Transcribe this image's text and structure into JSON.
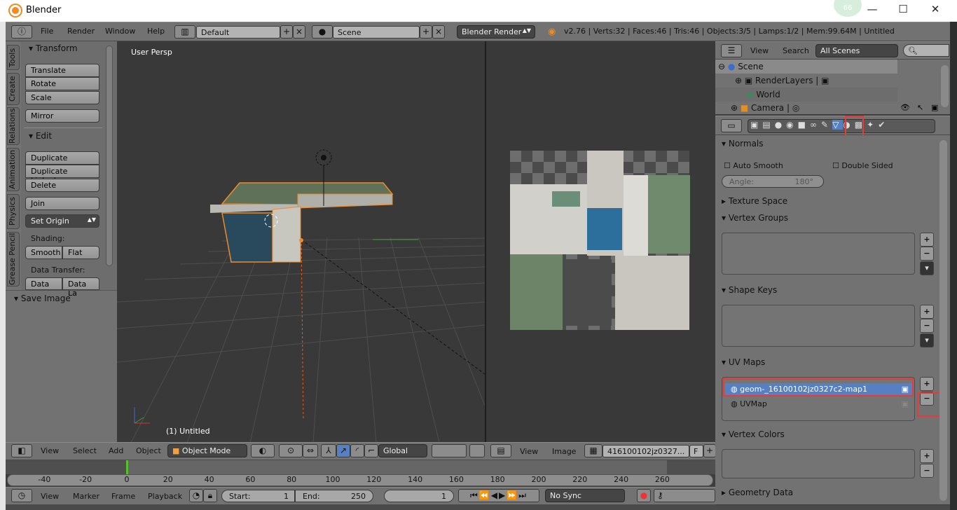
{
  "window": {
    "title": "Blender",
    "badge": "66"
  },
  "info_header": {
    "menus": [
      "File",
      "Render",
      "Window",
      "Help"
    ],
    "layout": "Default",
    "scene": "Scene",
    "engine": "Blender Render",
    "stats": "v2.76 | Verts:32 | Faces:46 | Tris:46 | Objects:3/5 | Lamps:1/2 | Mem:99.64M | Untitled"
  },
  "tool_shelf": {
    "tabs": [
      "Tools",
      "Create",
      "Relations",
      "Animation",
      "Physics",
      "Grease Pencil"
    ],
    "transform_title": "Transform",
    "transform_buttons": [
      "Translate",
      "Rotate",
      "Scale"
    ],
    "mirror": "Mirror",
    "edit_title": "Edit",
    "edit_buttons": [
      "Duplicate",
      "Duplicate Linked",
      "Delete"
    ],
    "join": "Join",
    "set_origin": "Set Origin",
    "shading_label": "Shading:",
    "smooth": "Smooth",
    "flat": "Flat",
    "data_transfer_label": "Data Transfer:",
    "data": "Data",
    "data_layout": "Data La",
    "save_image": "Save Image"
  },
  "viewport": {
    "view_label": "User Persp",
    "object_label": "(1) Untitled",
    "header": {
      "menus": [
        "View",
        "Select",
        "Add",
        "Object"
      ],
      "mode": "Object Mode",
      "orientation": "Global"
    }
  },
  "image_editor": {
    "header": {
      "menus": [
        "View",
        "Image"
      ],
      "image_name": "416100102jz0327...",
      "fake_user": "F"
    }
  },
  "timeline": {
    "ticks": [
      "-40",
      "-20",
      "0",
      "20",
      "40",
      "60",
      "80",
      "100",
      "120",
      "140",
      "160",
      "180",
      "200",
      "220",
      "240",
      "260"
    ],
    "menus": [
      "View",
      "Marker",
      "Frame",
      "Playback"
    ],
    "start_label": "Start:",
    "start": "1",
    "end_label": "End:",
    "end": "250",
    "current": "1",
    "sync": "No Sync"
  },
  "outliner": {
    "menus": [
      "View",
      "Search"
    ],
    "filter": "All Scenes",
    "items": [
      "Scene",
      "RenderLayers",
      "World",
      "Camera"
    ]
  },
  "properties": {
    "active_tab": "mesh-data",
    "normals": {
      "title": "Normals",
      "auto_smooth": "Auto Smooth",
      "double_sided": "Double Sided",
      "angle_label": "Angle:",
      "angle": "180°"
    },
    "texture_space": "Texture Space",
    "vertex_groups": "Vertex Groups",
    "shape_keys": "Shape Keys",
    "uv_maps": {
      "title": "UV Maps",
      "items": [
        "geom-_16100102jz0327c2-map1",
        "UVMap"
      ],
      "selected": 0
    },
    "vertex_colors": "Vertex Colors",
    "geometry_data": "Geometry Data"
  },
  "highlight_color": "#e8393d",
  "accent": "#5680c2"
}
